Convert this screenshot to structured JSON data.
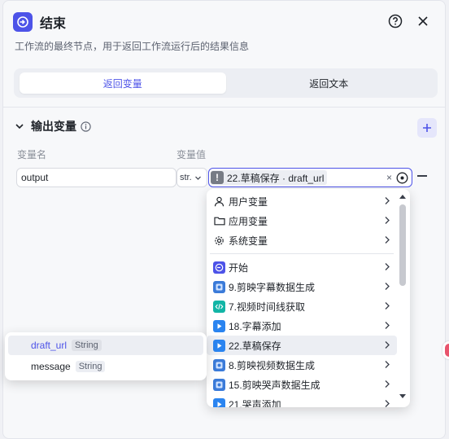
{
  "node": {
    "title": "结束",
    "description": "工作流的最终节点，用于返回工作流运行后的结果信息"
  },
  "tabs": [
    {
      "label": "返回变量",
      "active": true
    },
    {
      "label": "返回文本",
      "active": false
    }
  ],
  "output_section": {
    "title": "输出变量",
    "col_name_label": "变量名",
    "col_value_label": "变量值",
    "row": {
      "name": "output",
      "type_abbr": "str.",
      "reference": "22.草稿保存 · draft_url",
      "reference_icon": "!",
      "clear": "×"
    }
  },
  "variable_menu": {
    "groups": [
      {
        "label": "用户变量",
        "icon": "person-icon"
      },
      {
        "label": "应用变量",
        "icon": "folder-icon"
      },
      {
        "label": "系统变量",
        "icon": "gear-icon"
      }
    ],
    "nodes": [
      {
        "label": "开始",
        "icon": "start-icon",
        "color": "#4d53e8"
      },
      {
        "label": "9.剪映字幕数据生成",
        "icon": "plugin-icon",
        "color": "#3b7bd9"
      },
      {
        "label": "7.视频时间线获取",
        "icon": "code-icon",
        "color": "#12b5a6"
      },
      {
        "label": "18.字幕添加",
        "icon": "play-icon",
        "color": "#2a84f0"
      },
      {
        "label": "22.草稿保存",
        "icon": "play-icon",
        "color": "#2a84f0",
        "highlighted": true
      },
      {
        "label": "8.剪映视频数据生成",
        "icon": "plugin-icon",
        "color": "#3b7bd9"
      },
      {
        "label": "15.剪映哭声数据生成",
        "icon": "plugin-icon",
        "color": "#3b7bd9"
      },
      {
        "label": "21.哭声添加",
        "icon": "play-icon",
        "color": "#2a84f0"
      }
    ]
  },
  "field_menu": [
    {
      "name": "draft_url",
      "type": "String",
      "highlighted": true
    },
    {
      "name": "message",
      "type": "String",
      "highlighted": false
    }
  ],
  "colors": {
    "accent": "#4d53e8",
    "danger": "#e8546c"
  }
}
